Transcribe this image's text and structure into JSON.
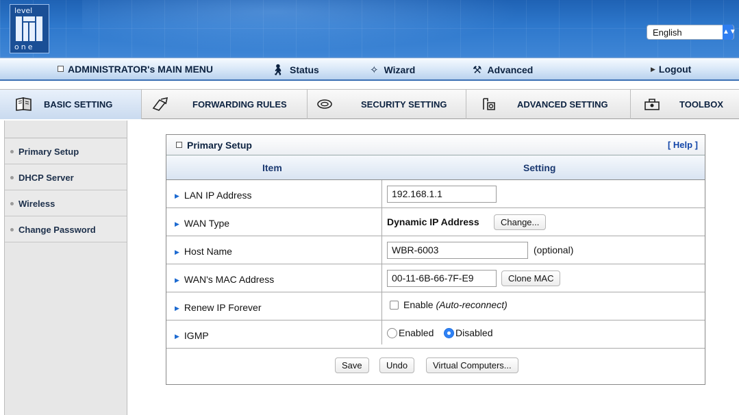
{
  "header": {
    "logo_top": "level",
    "logo_bottom": "one",
    "language": "English"
  },
  "main_menu": {
    "admin": "ADMINISTRATOR's MAIN MENU",
    "status": "Status",
    "wizard": "Wizard",
    "advanced": "Advanced",
    "logout": "Logout"
  },
  "tabs": [
    {
      "label": "BASIC SETTING",
      "icon": "book-icon"
    },
    {
      "label": "FORWARDING RULES",
      "icon": "forwarding-icon"
    },
    {
      "label": "SECURITY SETTING",
      "icon": "security-icon"
    },
    {
      "label": "ADVANCED SETTING",
      "icon": "advanced-icon"
    },
    {
      "label": "TOOLBOX",
      "icon": "toolbox-icon"
    }
  ],
  "sidebar": {
    "items": [
      {
        "label": "Primary Setup"
      },
      {
        "label": "DHCP Server"
      },
      {
        "label": "Wireless"
      },
      {
        "label": "Change Password"
      }
    ]
  },
  "panel": {
    "title": "Primary Setup",
    "help": "[ Help ]",
    "col_item": "Item",
    "col_setting": "Setting",
    "rows": {
      "lan_ip": {
        "label": "LAN IP Address",
        "value": "192.168.1.1"
      },
      "wan_type": {
        "label": "WAN Type",
        "value": "Dynamic IP Address",
        "button": "Change..."
      },
      "host_name": {
        "label": "Host Name",
        "value": "WBR-6003",
        "note": "(optional)"
      },
      "wan_mac": {
        "label": "WAN's MAC Address",
        "value": "00-11-6B-66-7F-E9",
        "button": "Clone MAC"
      },
      "renew_ip": {
        "label": "Renew IP Forever",
        "checkbox_label": "Enable",
        "checkbox_note": "(Auto-reconnect)",
        "checked": false
      },
      "igmp": {
        "label": "IGMP",
        "option_enabled": "Enabled",
        "option_disabled": "Disabled",
        "selected": "Disabled"
      }
    },
    "buttons": {
      "save": "Save",
      "undo": "Undo",
      "virtual": "Virtual Computers..."
    }
  }
}
